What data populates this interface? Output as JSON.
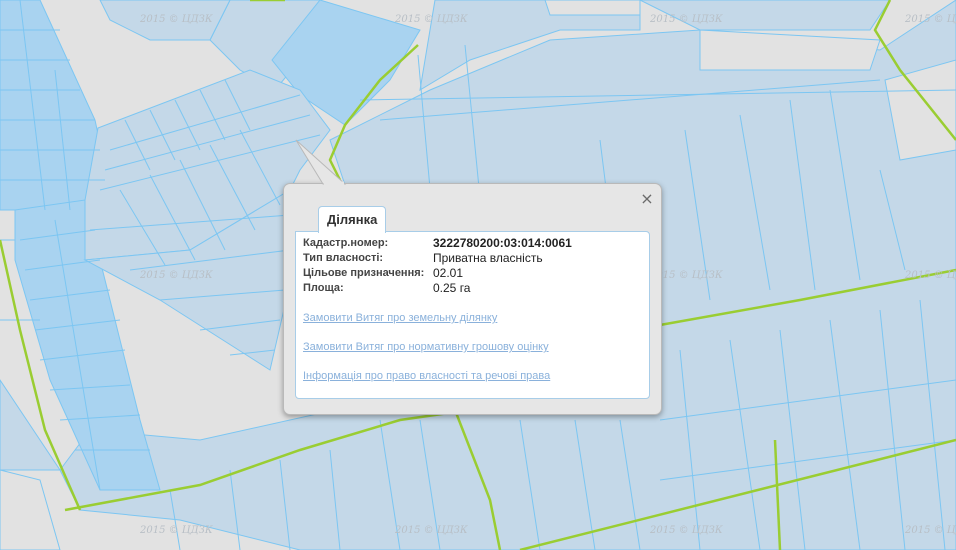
{
  "map": {
    "watermark": "2015 © ЦДЗК",
    "colors": {
      "background": "#e2e2e2",
      "parcel_fill": "#c4d8e8",
      "parcel_fill_dark": "#a9d3f0",
      "parcel_stroke": "#7cc6f2",
      "road": "#9acd32"
    }
  },
  "popup": {
    "close_label": "×",
    "tab_label": "Ділянка",
    "fields": [
      {
        "label": "Кадастр.номер:",
        "value": "3222780200:03:014:0061"
      },
      {
        "label": "Тип власності:",
        "value": "Приватна власність"
      },
      {
        "label": "Цільове призначення:",
        "value": "02.01"
      },
      {
        "label": "Площа:",
        "value": "0.25 га"
      }
    ],
    "links": [
      "Замовити Витяг про земельну ділянку",
      "Замовити Витяг про нормативну грошову оцінку",
      "Інформація про право власності та речові права"
    ]
  }
}
